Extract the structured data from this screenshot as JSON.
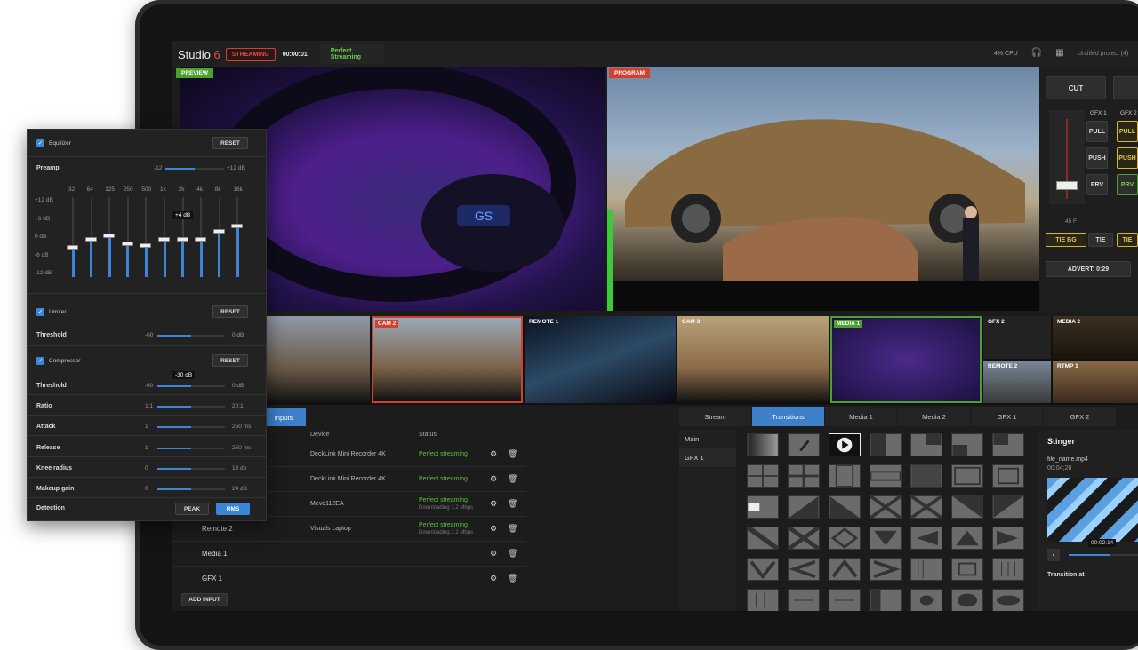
{
  "topbar": {
    "logo_text": "Studio",
    "logo_num": "6",
    "streaming_label": "STREAMING",
    "timer": "00:00:01",
    "stream_status": "Perfect Streaming",
    "cpu": "4% CPU",
    "project": "Untitled project (4)"
  },
  "viewers": {
    "preview_label": "PREVIEW",
    "program_label": "PROGRAM"
  },
  "controls": {
    "cut": "CUT",
    "gfx1": "GFX 1",
    "gfx2": "GFX 2",
    "pull": "PULL",
    "push": "PUSH",
    "prv": "PRV",
    "fade": "45 F",
    "tie_bg": "TIE BG",
    "tie": "TIE",
    "advert": "ADVERT: 0:29"
  },
  "thumbs": [
    "CAM 2",
    "REMOTE 1",
    "CAM 3",
    "MEDIA 1",
    "GFX 2",
    "MEDIA 2",
    "REMOTE 2",
    "RTMP 1"
  ],
  "inputs_tab": "Inputs",
  "table": {
    "col_device": "Device",
    "col_status": "Status",
    "add_input": "ADD INPUT",
    "rows": [
      {
        "name": "",
        "device": "DeckLink Mini Recorder 4K",
        "status": "Perfect streaming",
        "sub": ""
      },
      {
        "name": "",
        "device": "DeckLink Mini Recorder 4K",
        "status": "Perfect streaming",
        "sub": ""
      },
      {
        "name": "",
        "device": "Mevo112EA",
        "status": "Perfect streaming",
        "sub": "Downloading 1.2 Mbps"
      },
      {
        "name": "Remote 2",
        "device": "Visuals Laptop",
        "status": "Perfect streaming",
        "sub": "Downloading 1.2 Mbps"
      },
      {
        "name": "Media 1",
        "device": "",
        "status": "",
        "sub": ""
      },
      {
        "name": "GFX 1",
        "device": "",
        "status": "",
        "sub": ""
      }
    ]
  },
  "tabs": [
    "Stream",
    "Transitions",
    "Media 1",
    "Media 2",
    "GFX 1",
    "GFX 2"
  ],
  "sidelist": [
    "Main",
    "GFX 1"
  ],
  "stinger": {
    "title": "Stinger",
    "file": "file_name.mp4",
    "duration": "00:04;28",
    "time": "00:02:14",
    "transition_at": "Transition at"
  },
  "eq": {
    "equalizer": "Equilizer",
    "reset": "RESET",
    "preamp": "Preamp",
    "preamp_min": "-12",
    "preamp_max": "+12 dB",
    "bands": [
      "32",
      "64",
      "125",
      "250",
      "500",
      "1k",
      "2k",
      "4k",
      "8k",
      "16k"
    ],
    "db_labels": [
      "+12 dB",
      "+6 dB",
      "0 dB",
      "-6 dB",
      "-12 dB"
    ],
    "tooltip": "+4 dB",
    "band_levels": [
      0.37,
      0.47,
      0.51,
      0.41,
      0.39,
      0.47,
      0.47,
      0.47,
      0.57,
      0.63
    ],
    "limiter": "Limiter",
    "threshold": "Threshold",
    "lim_min": "-60",
    "lim_max": "0 dB",
    "compressor": "Compressor",
    "comp_tooltip": "-30 dB",
    "params": [
      {
        "label": "Threshold",
        "min": "-60",
        "max": "0 dB",
        "level": 0.5
      },
      {
        "label": "Ratio",
        "min": "1:1",
        "max": "20:1",
        "level": 0.5
      },
      {
        "label": "Attack",
        "min": "1",
        "max": "250 ms",
        "level": 0.5
      },
      {
        "label": "Release",
        "min": "1",
        "max": "250 ms",
        "level": 0.5
      },
      {
        "label": "Knee radius",
        "min": "0",
        "max": "18 db",
        "level": 0.5
      },
      {
        "label": "Makeup gain",
        "min": "0",
        "max": "24 dB",
        "level": 0.5
      }
    ],
    "detection": "Detection",
    "peak": "PEAK",
    "rms": "RMS"
  }
}
